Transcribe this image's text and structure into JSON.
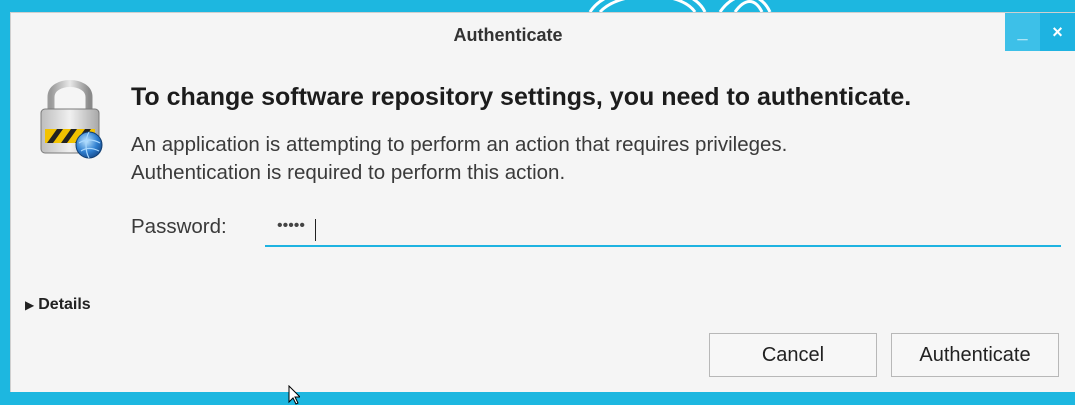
{
  "dialog": {
    "title": "Authenticate",
    "minimize_label": "_",
    "close_label": "×",
    "heading": "To change software repository settings, you need to authenticate.",
    "description_line1": "An application is attempting to perform an action that requires privileges.",
    "description_line2": "Authentication is required to perform this action.",
    "password_label": "Password:",
    "password_value": "•••••",
    "details_label": "Details",
    "cancel_label": "Cancel",
    "authenticate_label": "Authenticate"
  },
  "icons": {
    "lock": "lock-icon",
    "details_toggle": "triangle-right-icon",
    "mouse_cursor": "pointer-cursor-icon"
  },
  "colors": {
    "accent": "#1eb3e1",
    "dialog_bg": "#f5f5f5",
    "desktop_bg": "#1db7e0"
  }
}
